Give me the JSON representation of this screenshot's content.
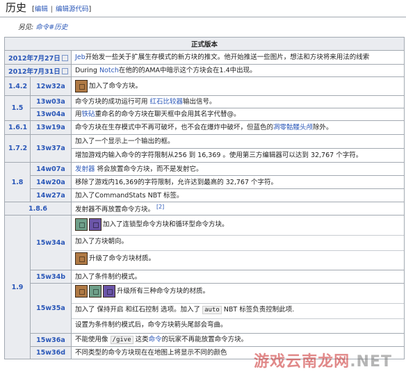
{
  "page": {
    "heading": "历史",
    "edit_label": "编辑",
    "edit_source_label": "编辑源代码",
    "see_also_prefix": "另见:",
    "see_also_link": "命令#历史"
  },
  "table": {
    "title": "正式版本",
    "rows": {
      "r1": {
        "date": "2012年7月27日",
        "link": "Jeb",
        "text": "开始发一些关于扩展生存模式的新方块的推文。他开始推送一些图片，想法和方块将来用法的线索"
      },
      "r2": {
        "date": "2012年7月31日",
        "pre": "During ",
        "link": "Notch",
        "text": "在他的的AMA中暗示这个方块会在1.4中出现。"
      },
      "r3": {
        "version": "1.4.2",
        "snapshot": "12w32a",
        "text": "加入了命令方块。"
      },
      "r4": {
        "version": "1.5",
        "snapshot": "13w03a",
        "pre": "命令方块的成功运行可用 ",
        "link": "红石比较器",
        "text": "输出信号。"
      },
      "r5": {
        "snapshot": "13w04a",
        "pre": "用",
        "link": "铁砧",
        "text": "重命名的命令方块在聊天框中会用其名字代替@。"
      },
      "r6": {
        "version": "1.6.1",
        "snapshot": "13w19a",
        "pre": "命令方块在生存模式中不再可破坏，也不会在爆炸中破坏，但蓝色的",
        "link": "凋零骷髅头颅",
        "text": "除外。"
      },
      "r7": {
        "version": "1.7.2",
        "snapshot": "13w37a",
        "text": "加入了一个显示上一个输出的框。"
      },
      "r8": {
        "text": "增加游戏内输入命令的字符限制从256 到 16,369 。使用第三方编辑器可以达到 32,767 个字符。"
      },
      "r9": {
        "version": "1.8",
        "snapshot": "14w07a",
        "link": "发射器",
        "text": " 将会放置命令方块，而不是发射它。"
      },
      "r10": {
        "snapshot": "14w20a",
        "text": "移除了游戏内16,369的字符限制，允许达到最高的 32,767 个字符。"
      },
      "r11": {
        "snapshot": "14w27a",
        "text": "加入了CommandStats NBT 标签。"
      },
      "r12": {
        "version": "1.8.6",
        "text": "发射器不再放置命令方块。",
        "ref": "[2]"
      },
      "r13": {
        "version": "1.9",
        "snapshot": "15w34a",
        "text_a": "加入了连锁型命令方块和循环型命令方块。",
        "text_b": "加入了方块朝向。",
        "text_c": "升级了命令方块材质。"
      },
      "r14": {
        "snapshot": "15w34b",
        "text": "加入了条件制约模式。"
      },
      "r15": {
        "snapshot": "15w35a",
        "text_a": "升级所有三种命令方块的材质。",
        "text_b1": "加入了 保持开启 和红石控制 选项。加入了 ",
        "code": "auto",
        "text_b2": " NBT 标签负责控制此项.",
        "text_c": "设置为条件制约模式后，命令方块箭头尾部会弯曲。"
      },
      "r16": {
        "snapshot": "15w36a",
        "pre": "不能使用像 ",
        "code": "/give",
        "mid": " 这类",
        "link": "命令",
        "text": "的玩家不再能放置命令方块。"
      },
      "r17": {
        "snapshot": "15w36d",
        "text": "不同类型的命令方块现在在地图上将显示不同的颜色"
      }
    }
  },
  "watermark": {
    "main": "游戏云南龙网",
    "suffix": ".NET"
  },
  "colors": {
    "link": "#2a57b8",
    "header_bg": "#eaecf0",
    "border": "#a2a9b1"
  },
  "icons": [
    "impulse-command-block-icon",
    "chain-command-block-icon",
    "repeating-command-block-icon",
    "external-link-icon"
  ]
}
